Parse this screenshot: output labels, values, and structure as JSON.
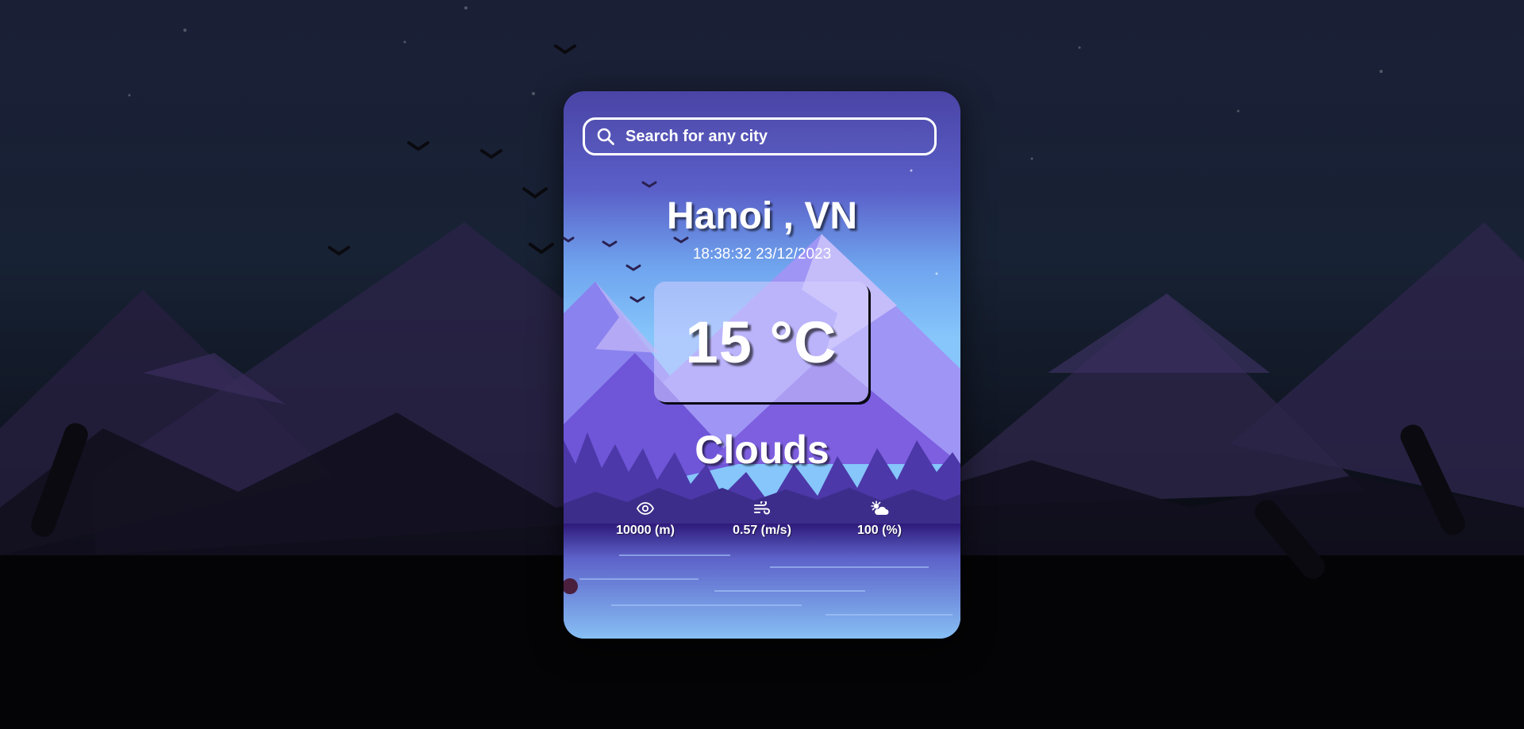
{
  "search": {
    "placeholder": "Search for any city",
    "icon": "search-icon"
  },
  "weather": {
    "city": "Hanoi , VN",
    "datetime": "18:38:32 23/12/2023",
    "temperature": "15 °C",
    "condition": "Clouds"
  },
  "stats": {
    "visibility": {
      "icon": "eye-icon",
      "value": "10000 (m)"
    },
    "wind": {
      "icon": "wind-icon",
      "value": "0.57 (m/s)"
    },
    "clouds": {
      "icon": "sun-cloud-icon",
      "value": "100 (%)"
    }
  },
  "colors": {
    "card_sky_top": "#4a4aa8",
    "card_sky_bottom": "#7ec3f5",
    "mountain_light": "#b7a6f0",
    "mountain_dark": "#6f4fd6",
    "forest": "#4f3aa6",
    "lake": "#6c8fe0",
    "page_bg_top": "#1b1f36",
    "page_bg_bottom": "#020203"
  }
}
